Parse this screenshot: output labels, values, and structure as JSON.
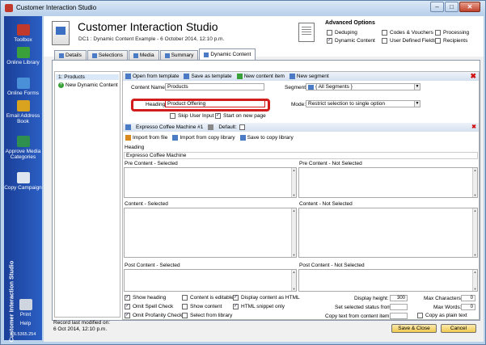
{
  "window": {
    "title": "Customer Interaction Studio",
    "min": "–",
    "max": "□",
    "close": "✕"
  },
  "sidebar": {
    "items": [
      {
        "label": "Toolbox",
        "color": "#c0392b"
      },
      {
        "label": "Online Library",
        "color": "#3aa13a"
      },
      {
        "label": "Online Forms",
        "color": "#4a90d9"
      },
      {
        "label": "Email Address Book",
        "color": "#d9a21f"
      },
      {
        "label": "Approve Media Categories",
        "color": "#2f8f4f"
      },
      {
        "label": "Copy Campaign",
        "color": "#dfe6f0"
      },
      {
        "label": "Print",
        "color": "#cfd6e0"
      },
      {
        "label": "Help",
        "color": ""
      }
    ],
    "brand": "Customer Interaction Studio",
    "version": "v 6.5365.254"
  },
  "header": {
    "title": "Customer Interaction Studio",
    "subtitle": "DC1 : Dynamic Content Example - 6 October 2014, 12:10 p.m.",
    "advanced_title": "Advanced Options",
    "options": [
      {
        "label": "Deduping",
        "checked": false
      },
      {
        "label": "Codes & Vouchers",
        "checked": false
      },
      {
        "label": "Processing",
        "checked": false
      },
      {
        "label": "Dynamic Content",
        "checked": true
      },
      {
        "label": "User Defined Fields",
        "checked": false
      },
      {
        "label": "Recipients",
        "checked": false
      }
    ]
  },
  "tabs": [
    {
      "label": "Details",
      "active": false
    },
    {
      "label": "Selections",
      "active": false
    },
    {
      "label": "Media",
      "active": false
    },
    {
      "label": "Summary",
      "active": false
    },
    {
      "label": "Dynamic Content",
      "active": true
    }
  ],
  "tree": {
    "items": [
      {
        "label": "1: Products"
      },
      {
        "label": "New Dynamic Content"
      }
    ]
  },
  "toolbar": {
    "open_template": "Open from template",
    "save_template": "Save as template",
    "new_content_item": "New content item",
    "new_segment": "New segment"
  },
  "form": {
    "content_name_label": "Content Name:",
    "content_name_value": "Products",
    "segment_label": "Segment:",
    "segment_value": "{ All Segments }",
    "heading_label": "Heading:",
    "heading_value": "Product Offering",
    "mode_label": "Mode:",
    "mode_value": "Restrict selection to single option",
    "skip_user_input": "Skip User Input",
    "start_new_page": "Start on new page"
  },
  "item": {
    "title": "Expresso Coffee Machine #1",
    "default_label": "Default:",
    "import_file": "Import from file",
    "import_copy": "Import from copy library",
    "save_copy": "Save to copy library",
    "heading_label": "Heading",
    "heading_value": "Expresso Coffee Machine",
    "pre_selected": "Pre Content - Selected",
    "pre_not_selected": "Pre Content - Not Selected",
    "content_selected": "Content - Selected",
    "content_not_selected": "Content - Not Selected",
    "post_selected": "Post Content - Selected",
    "post_not_selected": "Post Content - Not Selected"
  },
  "options": {
    "show_heading": "Show heading",
    "omit_spell": "Omit Spell Check",
    "omit_profanity": "Omit Profanity Check",
    "content_editable": "Content is editable",
    "show_content": "Show content",
    "select_library": "Select from library",
    "display_html": "Display content as HTML",
    "html_snippet": "HTML snippet only",
    "display_height_label": "Display height:",
    "display_height_value": "300",
    "set_status_label": "Set selected status from",
    "copy_text_label": "Copy text from content item:",
    "max_chars_label": "Max Characters:",
    "max_chars_value": "0",
    "max_words_label": "Max Words:",
    "max_words_value": "0",
    "copy_plain": "Copy as plain text"
  },
  "footer": {
    "status_line1": "Record last modified on:",
    "status_line2": "6 Oct 2014, 12:10 p.m.",
    "save_close": "Save & Close",
    "cancel": "Cancel"
  }
}
